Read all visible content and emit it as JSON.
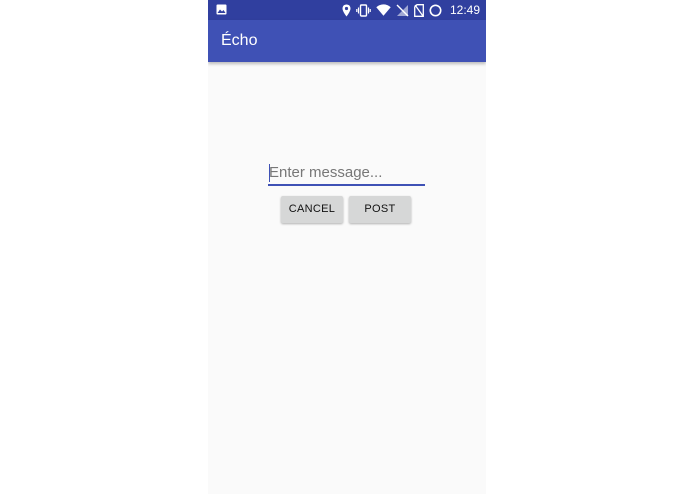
{
  "status_bar": {
    "time": "12:49",
    "icons": [
      "image-icon",
      "location-icon",
      "vibrate-icon",
      "wifi-icon",
      "no-signal-icon",
      "no-sim-icon",
      "battery-icon"
    ],
    "background": "#303f9f"
  },
  "app_bar": {
    "title": "Écho",
    "background": "#3f51b5"
  },
  "form": {
    "message_placeholder": "Enter message...",
    "message_value": "",
    "cancel_label": "CANCEL",
    "post_label": "POST"
  },
  "colors": {
    "accent": "#3f51b5",
    "screen_background": "#fafafa",
    "button_background": "#d6d7d7"
  }
}
